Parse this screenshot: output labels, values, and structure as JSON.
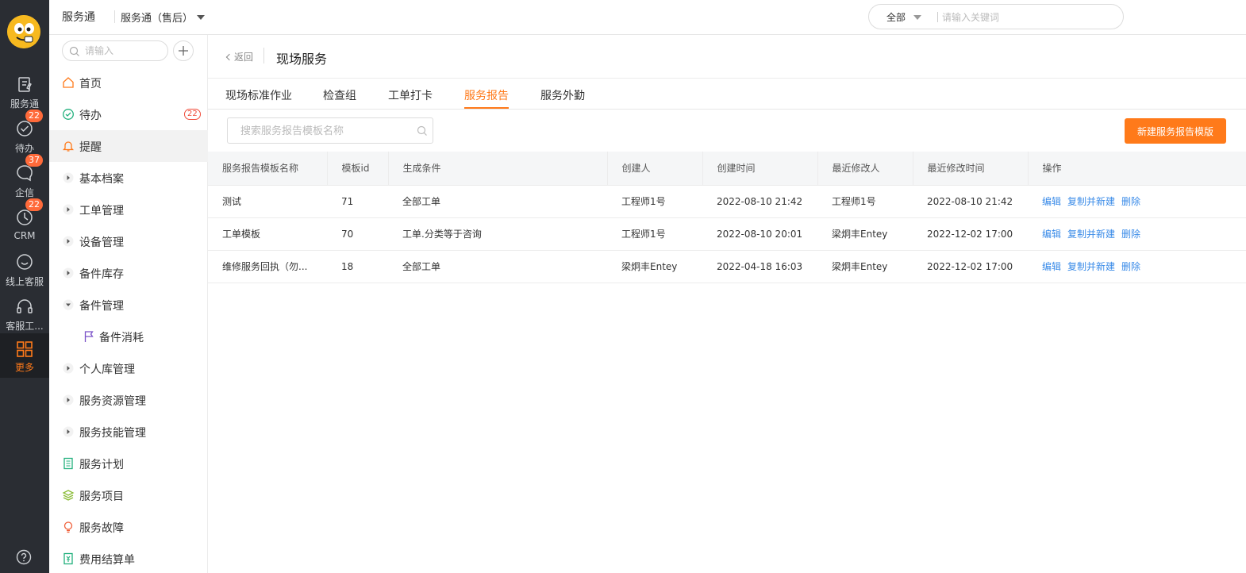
{
  "rail": {
    "items": [
      {
        "label": "服务通",
        "badge": ""
      },
      {
        "label": "待办",
        "badge": "22"
      },
      {
        "label": "企信",
        "badge": "37"
      },
      {
        "label": "CRM",
        "badge": "22"
      },
      {
        "label": "线上客服",
        "badge": ""
      },
      {
        "label": "客服工...",
        "badge": ""
      },
      {
        "label": "更多",
        "badge": ""
      }
    ]
  },
  "topbar": {
    "app_name": "服务通",
    "app_switch": "服务通（售后）",
    "search_scope": "全部",
    "search_placeholder": "请输入关键词"
  },
  "sidebar": {
    "search_placeholder": "请输入",
    "items": [
      {
        "label": "首页",
        "badge": ""
      },
      {
        "label": "待办",
        "badge": "22"
      },
      {
        "label": "提醒",
        "badge": ""
      },
      {
        "label": "基本档案",
        "badge": ""
      },
      {
        "label": "工单管理",
        "badge": ""
      },
      {
        "label": "设备管理",
        "badge": ""
      },
      {
        "label": "备件库存",
        "badge": ""
      },
      {
        "label": "备件管理",
        "badge": ""
      },
      {
        "label": "备件消耗",
        "badge": ""
      },
      {
        "label": "个人库管理",
        "badge": ""
      },
      {
        "label": "服务资源管理",
        "badge": ""
      },
      {
        "label": "服务技能管理",
        "badge": ""
      },
      {
        "label": "服务计划",
        "badge": ""
      },
      {
        "label": "服务项目",
        "badge": ""
      },
      {
        "label": "服务故障",
        "badge": ""
      },
      {
        "label": "费用结算单",
        "badge": ""
      }
    ]
  },
  "main": {
    "back_label": "返回",
    "title": "现场服务",
    "tabs": [
      "现场标准作业",
      "检查组",
      "工单打卡",
      "服务报告",
      "服务外勤"
    ],
    "active_tab": "服务报告",
    "search_placeholder": "搜索服务报告模板名称",
    "new_button": "新建服务报告模版",
    "table": {
      "headers": [
        "服务报告模板名称",
        "模板id",
        "生成条件",
        "创建人",
        "创建时间",
        "最近修改人",
        "最近修改时间",
        "操作"
      ],
      "rows": [
        [
          "测试",
          "71",
          "全部工单",
          "工程师1号",
          "2022-08-10 21:42",
          "工程师1号",
          "2022-08-10 21:42"
        ],
        [
          "工单模板",
          "70",
          "工单.分类等于咨询",
          "工程师1号",
          "2022-08-10 20:01",
          "梁炯丰Entey",
          "2022-12-02 17:00"
        ],
        [
          "维修服务回执（勿...",
          "18",
          "全部工单",
          "梁炯丰Entey",
          "2022-04-18 16:03",
          "梁炯丰Entey",
          "2022-12-02 17:00"
        ]
      ],
      "actions": [
        "编辑",
        "复制并新建",
        "删除"
      ]
    }
  }
}
